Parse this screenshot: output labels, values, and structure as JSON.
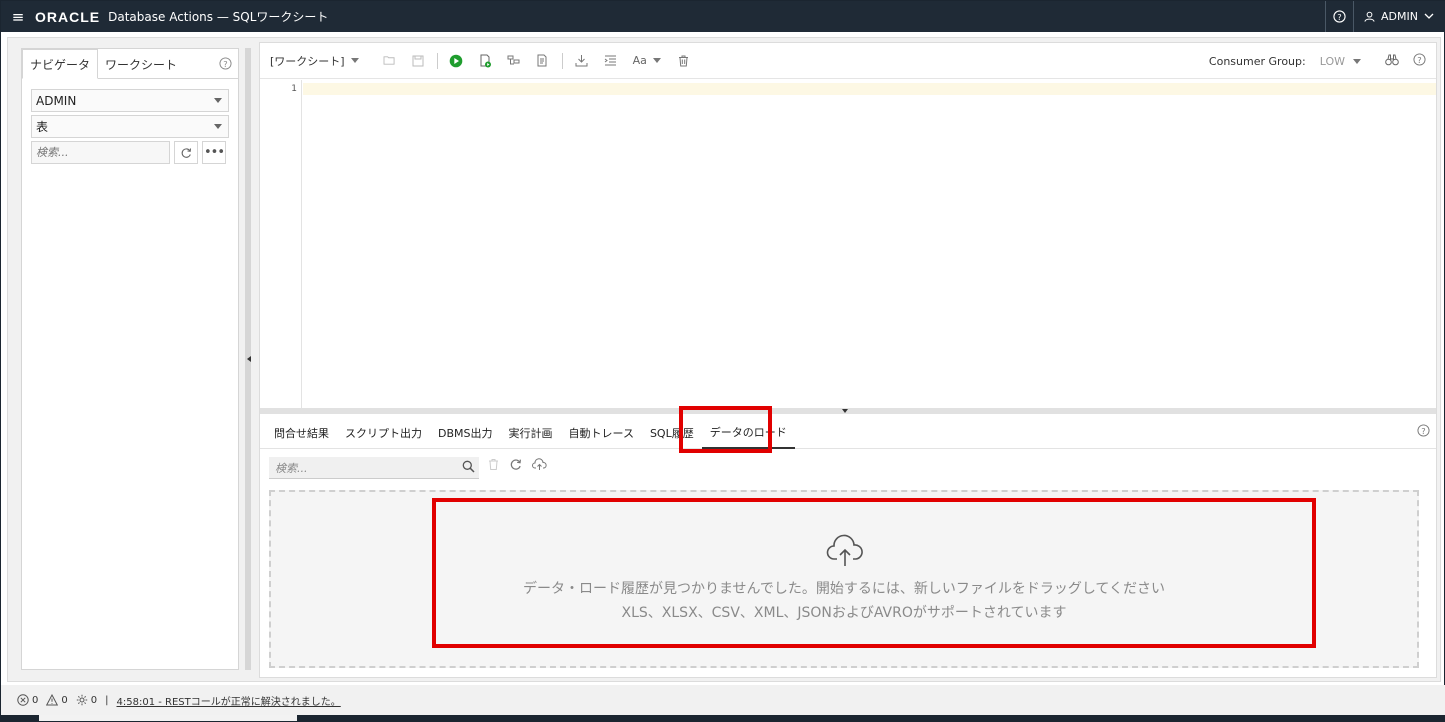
{
  "header": {
    "logo_text": "ORACLE",
    "title": "Database Actions — SQLワークシート",
    "user": "ADMIN"
  },
  "navigator": {
    "tabs": [
      {
        "label": "ナビゲータ",
        "active": true
      },
      {
        "label": "ワークシート",
        "active": false
      }
    ],
    "schema_select": "ADMIN",
    "object_type_select": "表",
    "search_placeholder": "検索..."
  },
  "toolbar": {
    "worksheet_dropdown": "[ワークシート]",
    "font_size_label": "Aa",
    "consumer_group_label": "Consumer Group:",
    "consumer_group_value": "LOW"
  },
  "editor": {
    "line_numbers": [
      "1"
    ]
  },
  "result_tabs": [
    {
      "label": "問合せ結果",
      "active": false
    },
    {
      "label": "スクリプト出力",
      "active": false
    },
    {
      "label": "DBMS出力",
      "active": false
    },
    {
      "label": "実行計画",
      "active": false
    },
    {
      "label": "自動トレース",
      "active": false
    },
    {
      "label": "SQL履歴",
      "active": false
    },
    {
      "label": "データのロード",
      "active": true
    }
  ],
  "data_load": {
    "search_placeholder": "検索...",
    "empty_message": "データ・ロード履歴が見つかりませんでした。開始するには、新しいファイルをドラッグしてください",
    "supported_message": "XLS、XLSX、CSV、XML、JSONおよびAVROがサポートされています"
  },
  "footer": {
    "error_count": "0",
    "warning_count": "0",
    "task_count": "0",
    "separator": "|",
    "status_message": "4:58:01 - RESTコールが正常に解決されました。"
  },
  "colors": {
    "header_bg": "#1f2a36",
    "highlight": "#e10000",
    "run_green": "#1f9d2e"
  }
}
